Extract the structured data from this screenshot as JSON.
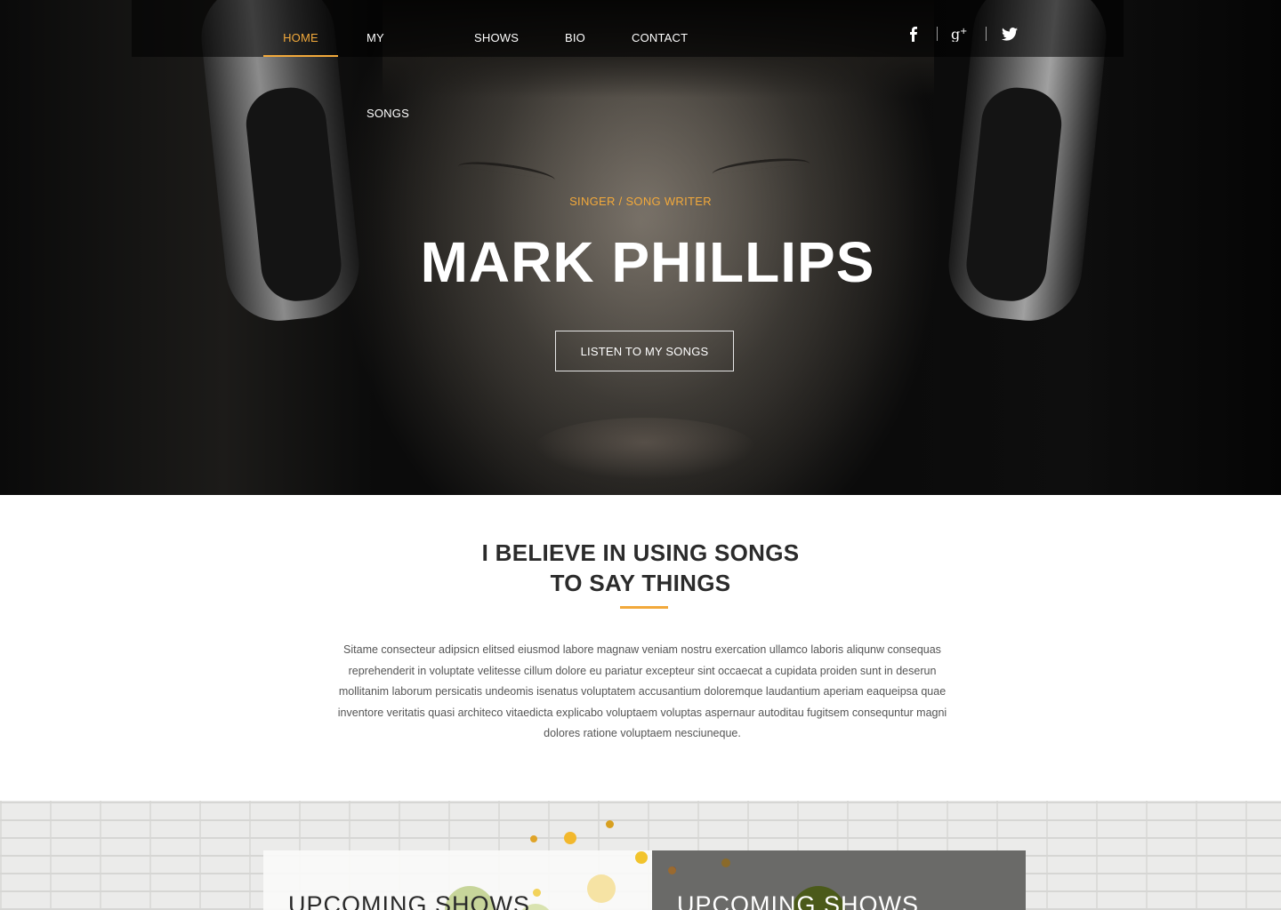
{
  "nav": {
    "items": [
      {
        "label": "HOME",
        "active": true
      },
      {
        "label": "MY SONGS",
        "active": false
      },
      {
        "label": "SHOWS",
        "active": false
      },
      {
        "label": "BIO",
        "active": false
      },
      {
        "label": "CONTACT",
        "active": false
      }
    ],
    "social": [
      "facebook-icon",
      "google-plus-icon",
      "twitter-icon"
    ]
  },
  "hero": {
    "subtitle": "SINGER / SONG WRITER",
    "title": "MARK PHILLIPS",
    "cta": "LISTEN TO MY SONGS"
  },
  "about": {
    "title_line1": "I BELIEVE IN USING SONGS",
    "title_line2": "TO SAY THINGS",
    "text": "Sitame consecteur adipsicn elitsed eiusmod labore magnaw veniam nostru exercation ullamco laboris aliqunw consequas reprehenderit in voluptate velitesse cillum dolore eu pariatur excepteur sint occaecat a cupidata proiden sunt in deserun mollitanim laborum persicatis undeomis isenatus voluptatem accusantium doloremque laudantium aperiam eaqueipsa quae inventore veritatis quasi architeco vitaedicta explicabo voluptaem voluptas aspernaur autoditau fugitsem consequntur magni dolores ratione voluptaem nesciuneque."
  },
  "shows": {
    "left_title": "UPCOMING SHOWS",
    "right_title": "UPCOMING SHOWS"
  },
  "colors": {
    "accent": "#f2a93b"
  }
}
